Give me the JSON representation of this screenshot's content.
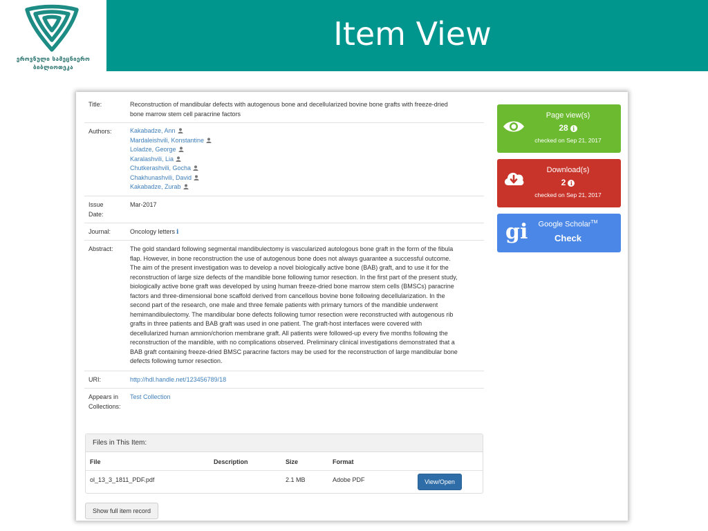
{
  "header": {
    "logo_line1": "ეროვნული სამეცნიერო",
    "logo_line2": "ბიბლიოთეკა",
    "title": "Item View"
  },
  "item": {
    "title_label": "Title:",
    "title_line1": "Reconstruction of mandibular defects with autogenous bone and decellularized bovine bone grafts with freeze-dried",
    "title_line2": "bone marrow stem cell paracrine factors",
    "authors_label": "Authors:",
    "authors": [
      "Kakabadze, Ann",
      "Mardaleishvili, Konstantine",
      "Loladze, George",
      "Karalashvili, Lia",
      "Chutkerashvili, Gocha",
      "Chakhunashvili, David",
      "Kakabadze, Zurab"
    ],
    "issue_label_1": "Issue",
    "issue_label_2": "Date:",
    "issue_date": "Mar-2017",
    "journal_label": "Journal:",
    "journal": "Oncology letters",
    "abstract_label": "Abstract:",
    "abstract_lines": [
      "The gold standard following segmental mandibulectomy is vascularized autologous bone graft in the form of the fibula",
      "flap. However, in bone reconstruction the use of autogenous bone does not always guarantee a successful outcome.",
      "The aim of the present investigation was to develop a novel biologically active bone (BAB) graft, and to use it for the",
      "reconstruction of large size defects of the mandible bone following tumor resection. In the first part of the present study,",
      "biologically active bone graft was developed by using human freeze-dried bone marrow stem cells (BMSCs) paracrine",
      "factors and three-dimensional bone scaffold derived from cancellous bovine bone following decellularization. In the",
      "second part of the research, one male and three female patients with primary tumors of the mandible underwent",
      "hemimandibulectomy. The mandibular bone defects following tumor resection were reconstructed with autogenous rib",
      "grafts in three patients and BAB graft was used in one patient. The graft-host interfaces were covered with",
      "decellularized human amnion/chorion membrane graft. All patients were followed-up every five months following the",
      "reconstruction of the mandible, with no complications observed. Preliminary clinical investigations demonstrated that a",
      "BAB graft containing freeze-dried BMSC paracrine factors may be used for the reconstruction of large mandibular bone",
      "defects following tumor resection."
    ],
    "uri_label": "URI:",
    "uri": "http://hdl.handle.net/123456789/18",
    "collections_label_1": "Appears in",
    "collections_label_2": "Collections:",
    "collection": "Test Collection"
  },
  "stats": {
    "views_label": "Page view(s)",
    "views_count": "28",
    "views_checked": "checked on Sep 21, 2017",
    "downloads_label": "Download(s)",
    "downloads_count": "2",
    "downloads_checked": "checked on Sep 21, 2017",
    "scholar_label": "Google Scholar",
    "scholar_tm": "TM",
    "scholar_action": "Check",
    "colors": {
      "views": "#6bba2f",
      "downloads": "#c9342a",
      "scholar": "#4a87e6"
    }
  },
  "files": {
    "heading": "Files in This Item:",
    "col_file": "File",
    "col_description": "Description",
    "col_size": "Size",
    "col_format": "Format",
    "file_name": "ol_13_3_1811_PDF.pdf",
    "file_description": "",
    "file_size": "2.1 MB",
    "file_format": "Adobe PDF",
    "view_button": "View/Open"
  },
  "show_full_button": "Show full item record",
  "colors": {
    "banner": "#00958d",
    "link": "#3e7fba"
  }
}
